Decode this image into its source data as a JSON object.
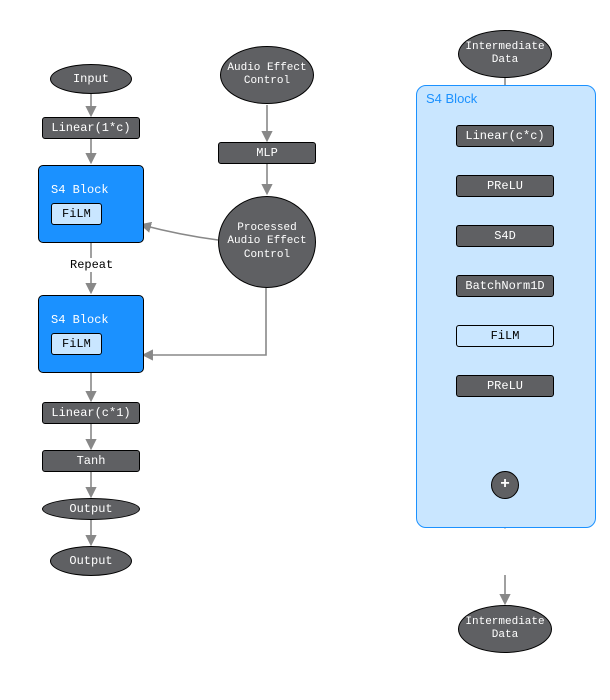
{
  "left": {
    "input": "Input",
    "linear_in": "Linear(1*c)",
    "s4block_label": "S4 Block",
    "film": "FiLM",
    "repeat": "Repeat",
    "linear_out": "Linear(c*1)",
    "tanh": "Tanh",
    "output": "Output"
  },
  "middle": {
    "audio_ctrl": "Audio Effect Control",
    "mlp": "MLP",
    "processed": "Processed Audio Effect Control"
  },
  "right": {
    "panel_title": "S4 Block",
    "inter_in": "Intermediate Data",
    "linear_cc": "Linear(c*c)",
    "prelu": "PReLU",
    "s4d": "S4D",
    "batchnorm": "BatchNorm1D",
    "film": "FiLM",
    "plus": "+",
    "inter_out": "Intermediate Data"
  }
}
